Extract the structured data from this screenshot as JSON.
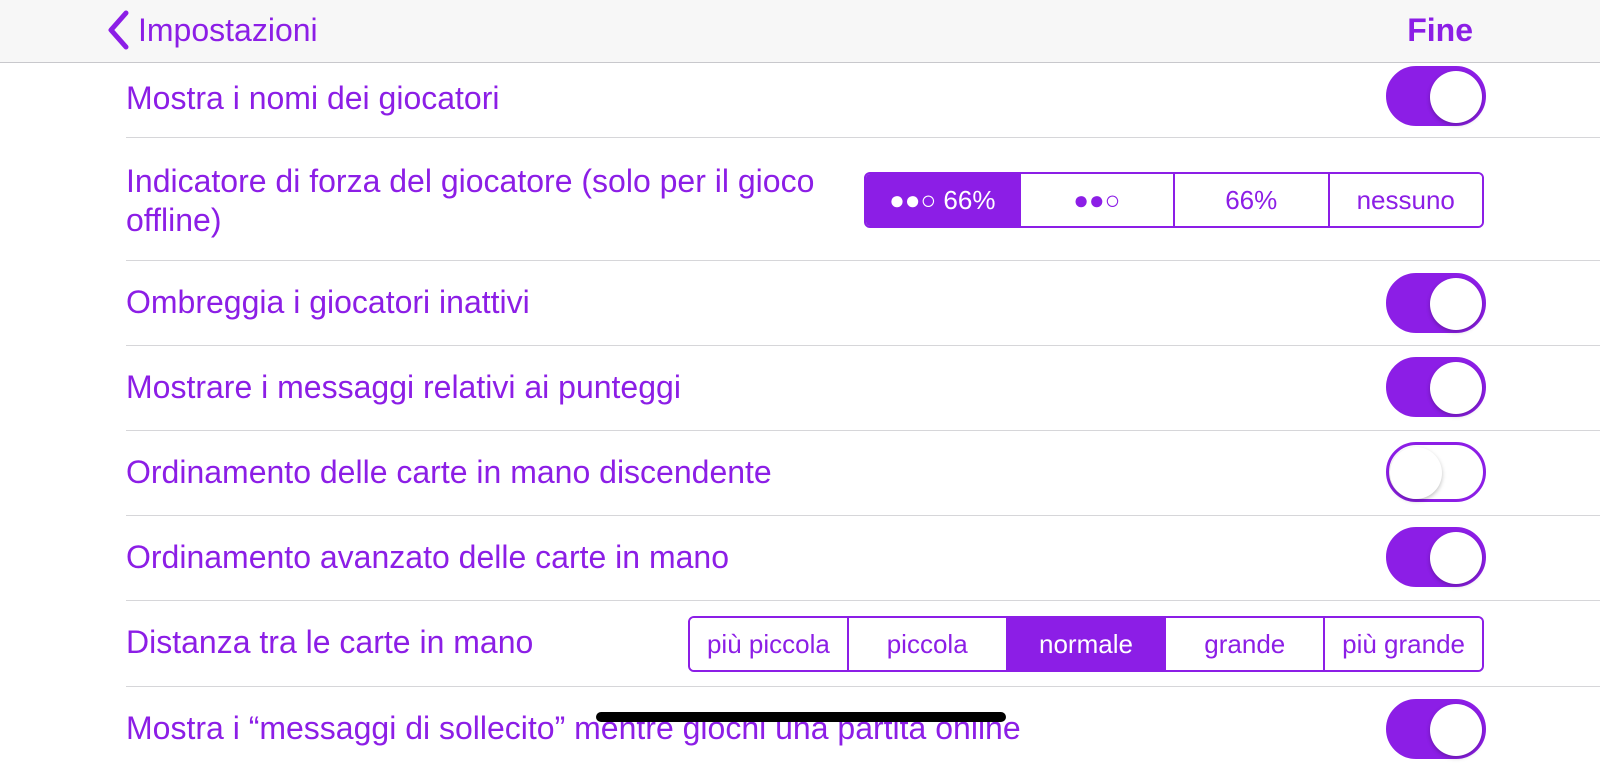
{
  "navbar": {
    "back_label": "Impostazioni",
    "done_label": "Fine"
  },
  "settings": [
    {
      "label": "Mostra i nomi dei giocatori",
      "type": "toggle",
      "on": true
    },
    {
      "label": "Indicatore di forza del giocatore (solo per il gioco offline)",
      "type": "segmented",
      "options": [
        "●●○ 66%",
        "●●○",
        "66%",
        "nessuno"
      ],
      "selected": 0
    },
    {
      "label": "Ombreggia i giocatori inattivi",
      "type": "toggle",
      "on": true
    },
    {
      "label": "Mostrare i messaggi relativi ai punteggi",
      "type": "toggle",
      "on": true
    },
    {
      "label": "Ordinamento delle carte in mano discendente",
      "type": "toggle",
      "on": false
    },
    {
      "label": "Ordinamento avanzato delle carte in mano",
      "type": "toggle",
      "on": true
    },
    {
      "label": "Distanza tra le carte in mano",
      "type": "segmented",
      "options": [
        "più piccola",
        "piccola",
        "normale",
        "grande",
        "più grande"
      ],
      "selected": 2
    },
    {
      "label": "Mostra i “messaggi di sollecito” mentre giochi una partita online",
      "type": "toggle",
      "on": true
    }
  ],
  "colors": {
    "accent": "#8c1ee6",
    "navbar_bg": "#f7f7f7",
    "separator": "#d6d6d9"
  }
}
